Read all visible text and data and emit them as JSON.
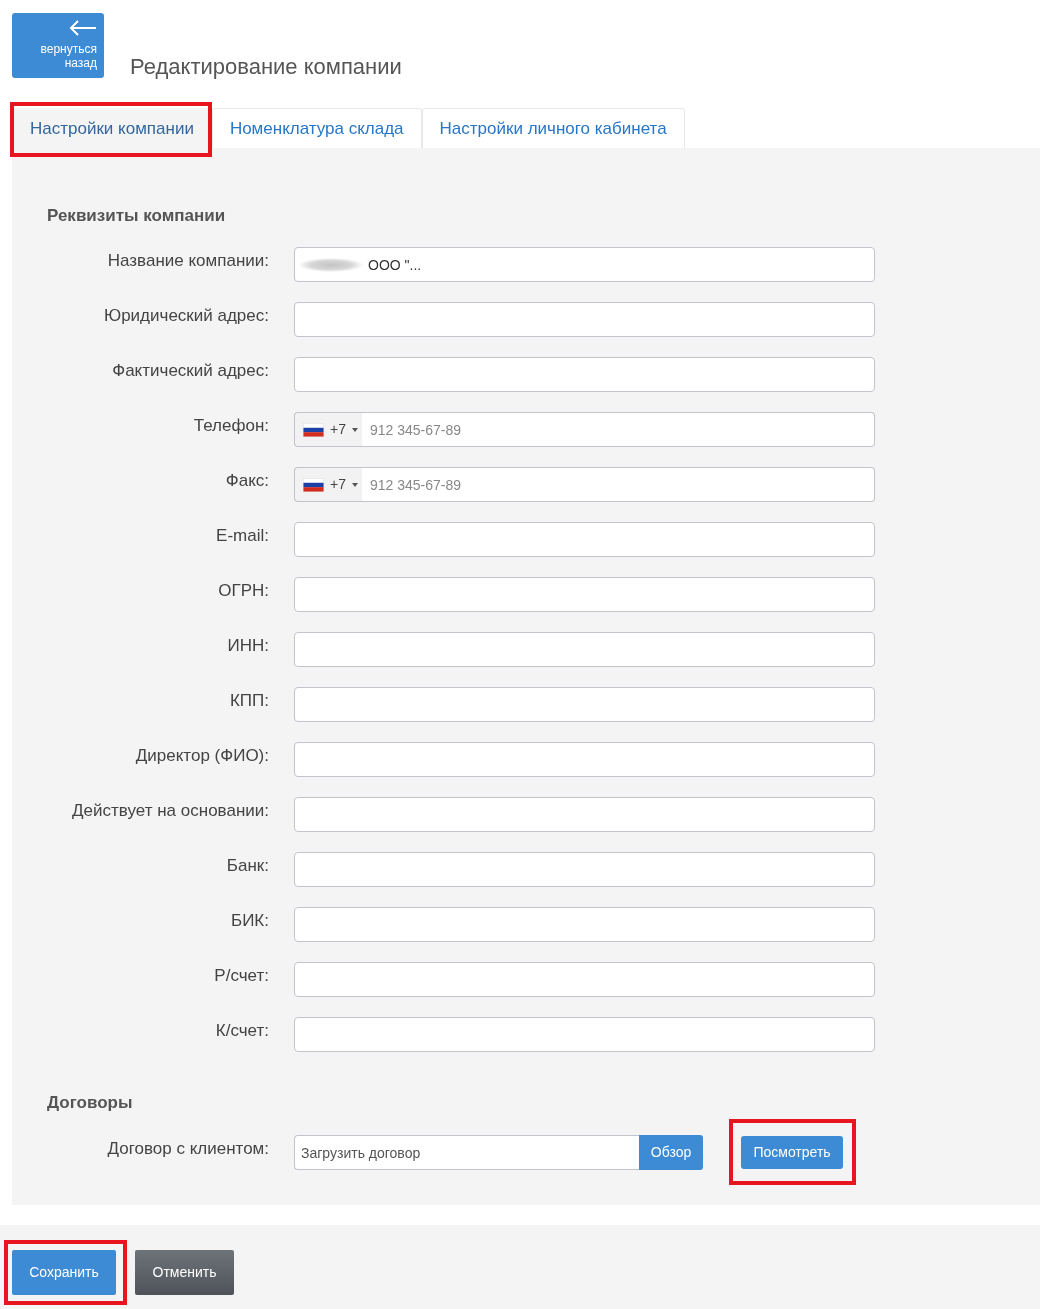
{
  "back_button": {
    "label": "вернуться назад"
  },
  "title": "Редактирование компании",
  "tabs": [
    {
      "label": "Настройки компании",
      "selected": true,
      "highlighted": true
    },
    {
      "label": "Номенклатура склада",
      "selected": false,
      "highlighted": false
    },
    {
      "label": "Настройки личного кабинета",
      "selected": false,
      "highlighted": false
    }
  ],
  "sections": [
    {
      "heading": "Реквизиты компании",
      "fields": [
        {
          "kind": "text",
          "label": "Название компании:",
          "value": "ООО \"...",
          "redacted": true
        },
        {
          "kind": "text",
          "label": "Юридический адрес:"
        },
        {
          "kind": "text",
          "label": "Фактический адрес:"
        },
        {
          "kind": "phone",
          "label": "Телефон:",
          "country_code": "+7",
          "placeholder": "912 345-67-89"
        },
        {
          "kind": "phone",
          "label": "Факс:",
          "country_code": "+7",
          "placeholder": "912 345-67-89"
        },
        {
          "kind": "text",
          "label": "E-mail:"
        },
        {
          "kind": "text",
          "label": "ОГРН:"
        },
        {
          "kind": "text",
          "label": "ИНН:"
        },
        {
          "kind": "text",
          "label": "КПП:"
        },
        {
          "kind": "text",
          "label": "Директор (ФИО):"
        },
        {
          "kind": "text",
          "label": "Действует на основании:"
        },
        {
          "kind": "text",
          "label": "Банк:"
        },
        {
          "kind": "text",
          "label": "БИК:"
        },
        {
          "kind": "text",
          "label": "Р/счет:"
        },
        {
          "kind": "text",
          "label": "К/счет:"
        }
      ]
    },
    {
      "heading": "Договоры",
      "fields": [
        {
          "kind": "file",
          "label": "Договор с клиентом:",
          "placeholder": "Загрузить договор",
          "browse_button": "Обзор",
          "view_button": {
            "label": "Посмотреть",
            "highlighted": true
          }
        }
      ]
    }
  ],
  "footer": {
    "buttons": [
      {
        "kind": "primary",
        "label": "Сохранить",
        "highlighted": true
      },
      {
        "kind": "secondary",
        "label": "Отменить",
        "highlighted": false
      }
    ]
  }
}
